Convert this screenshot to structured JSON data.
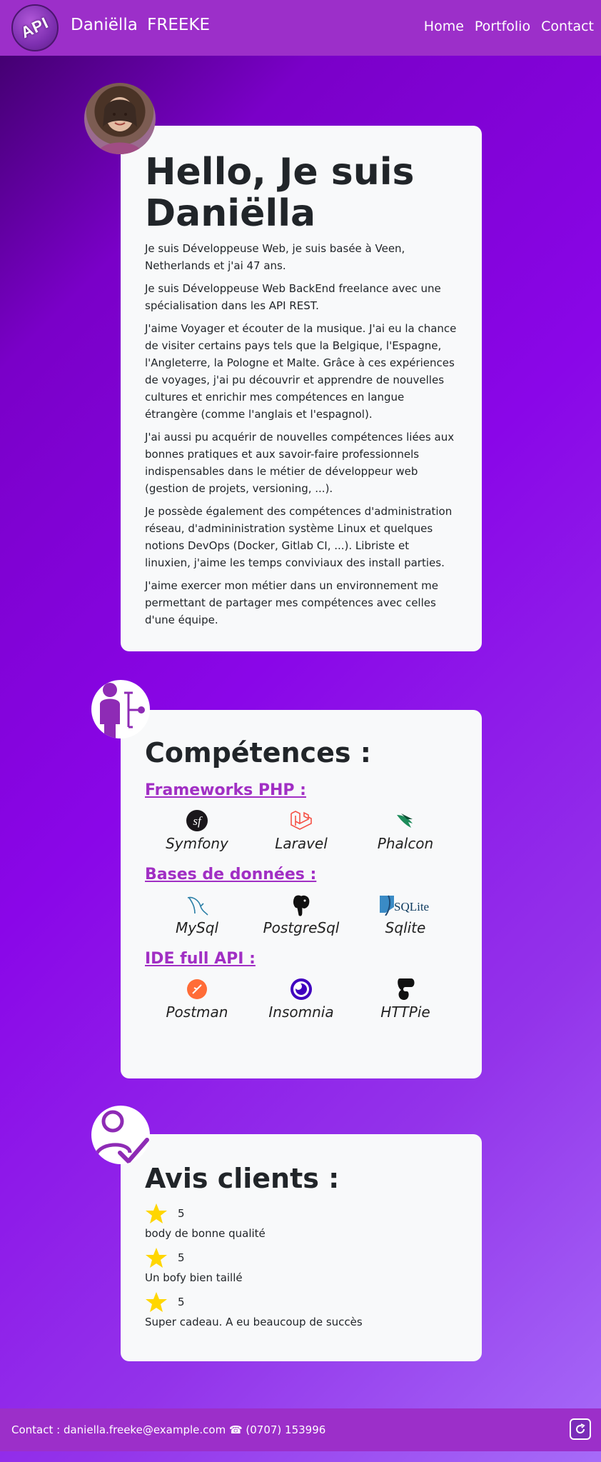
{
  "navbar": {
    "logo_text": "API",
    "brand": "Daniëlla FREEKE",
    "links": [
      "Home",
      "Portfolio",
      "Contact"
    ]
  },
  "about": {
    "title": "Hello, Je suis Daniëlla",
    "paragraphs": [
      "Je suis Développeuse Web, je suis basée à Veen, Netherlands et j'ai 47 ans.",
      "Je suis Développeuse Web BackEnd freelance avec une spécialisation dans les API REST.",
      "J'aime Voyager et écouter de la musique. J'ai eu la chance de visiter certains pays tels que la Belgique, l'Espagne, l'Angleterre, la Pologne et Malte. Grâce à ces expériences de voyages, j'ai pu découvrir et apprendre de nouvelles cultures et enrichir mes compétences en langue étrangère (comme l'anglais et l'espagnol).",
      "J'ai aussi pu acquérir de nouvelles compétences liées aux bonnes pratiques et aux savoir-faire professionnels indispensables dans le métier de développeur web (gestion de projets, versioning, ...).",
      "Je possède également des compétences d'administration réseau, d'admininistration système Linux et quelques notions DevOps (Docker, Gitlab CI, ...). Libriste et linuxien, j'aime les temps conviviaux des install parties.",
      "J'aime exercer mon métier dans un environnement me permettant de partager mes compétences avec celles d'une équipe."
    ]
  },
  "skills": {
    "title": "Compétences :",
    "groups": [
      {
        "label": "Frameworks PHP :",
        "items": [
          {
            "name": "Symfony",
            "icon": "symfony-icon"
          },
          {
            "name": "Laravel",
            "icon": "laravel-icon"
          },
          {
            "name": "Phalcon",
            "icon": "phalcon-icon"
          }
        ]
      },
      {
        "label": "Bases de données :",
        "items": [
          {
            "name": "MySql",
            "icon": "mysql-icon"
          },
          {
            "name": "PostgreSql",
            "icon": "postgresql-icon"
          },
          {
            "name": "Sqlite",
            "icon": "sqlite-icon",
            "logo_text": "SQLite"
          }
        ]
      },
      {
        "label": "IDE full API :",
        "items": [
          {
            "name": "Postman",
            "icon": "postman-icon"
          },
          {
            "name": "Insomnia",
            "icon": "insomnia-icon"
          },
          {
            "name": "HTTPie",
            "icon": "httpie-icon"
          }
        ]
      }
    ]
  },
  "reviews": {
    "title": "Avis clients :",
    "items": [
      {
        "rating": "5",
        "text": "body de bonne qualité"
      },
      {
        "rating": "5",
        "text": "Un bofy bien taillé"
      },
      {
        "rating": "5",
        "text": "Super cadeau. A eu beaucoup de succès"
      }
    ]
  },
  "footer": {
    "contact": "Contact : daniella.freeke@example.com ☎ (0707) 153996"
  },
  "colors": {
    "navbar": "#9c2fc9",
    "accent": "#a12fc4",
    "card": "#f8f9fa",
    "star": "#ffd600"
  }
}
